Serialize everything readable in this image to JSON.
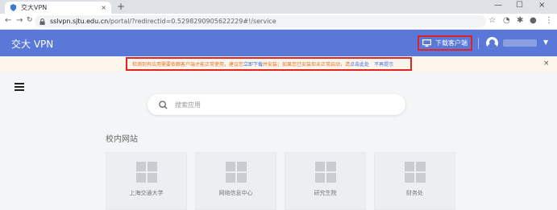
{
  "browser": {
    "tab_title": "交大VPN",
    "tab_close": "×",
    "new_tab": "+",
    "win_min": "—",
    "win_max": "☐",
    "win_close": "×",
    "url_host": "sslvpn.sjtu.edu.cn",
    "url_path": "/portal/?redirectid=0.5298290905622229#!/service",
    "icons": [
      "back-icon",
      "forward-icon",
      "reload-icon",
      "lock-icon",
      "star-icon",
      "extension-icon",
      "puzzle-icon",
      "profile-icon",
      "menu-icon"
    ]
  },
  "header": {
    "brand": "交大 VPN",
    "download_label": "下载客户端",
    "accent": "#5a78d8"
  },
  "notice": {
    "text_1": "检测到有应用需要依赖客户端才能正常使用，建议您",
    "link_download": "立即下载",
    "text_2": "并安装；如果您已安装但未正常启动，请",
    "link_start": "点击此处",
    "dismiss": "不再提示",
    "close": "×"
  },
  "search": {
    "placeholder": "搜索应用"
  },
  "section": {
    "title": "校内网站"
  },
  "cards": [
    {
      "label": "上海交通大学"
    },
    {
      "label": "网络信息中心"
    },
    {
      "label": "研究生院"
    },
    {
      "label": "财务处"
    }
  ]
}
